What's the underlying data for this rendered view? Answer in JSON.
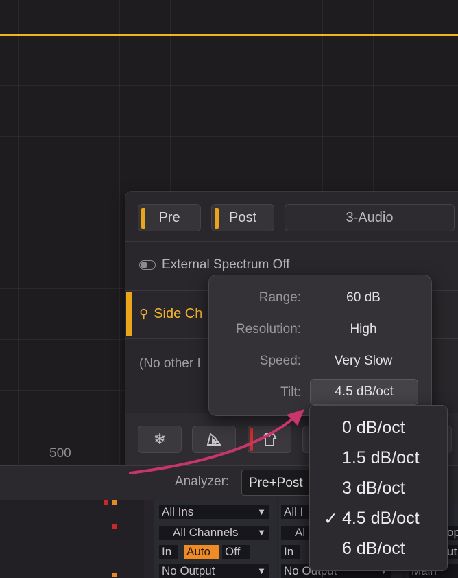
{
  "eq": {
    "freq_label": "500"
  },
  "panel": {
    "pre_label": "Pre",
    "post_label": "Post",
    "source_label": "3-Audio",
    "external_spectrum": "External Spectrum Off",
    "side_chain": "Side Ch",
    "no_other": "(No other I",
    "toolbar_icons": [
      "snowflake-icon",
      "cursor-shape-icon",
      "shirt-icon"
    ]
  },
  "popover": {
    "rows": [
      {
        "label": "Range:",
        "value": "60 dB"
      },
      {
        "label": "Resolution:",
        "value": "High"
      },
      {
        "label": "Speed:",
        "value": "Very Slow"
      },
      {
        "label": "Tilt:",
        "value": "4.5 dB/oct"
      }
    ]
  },
  "menu": {
    "items": [
      "0 dB/oct",
      "1.5 dB/oct",
      "3 dB/oct",
      "4.5 dB/oct",
      "6 dB/oct"
    ],
    "selected_index": 3,
    "check": "✓"
  },
  "analyzer_bar": {
    "label": "Analyzer:",
    "value": "Pre+Post"
  },
  "mixer": {
    "strip1": {
      "input": "All Ins",
      "channels": "All Channels",
      "in": "In",
      "auto": "Auto",
      "off": "Off",
      "output": "No Output"
    },
    "strip2": {
      "input": "All I",
      "channels": "Al",
      "in": "In",
      "output": "No Output"
    },
    "strip3": {
      "channels": "op",
      "auto": "ut",
      "output": "Main"
    }
  },
  "colors": {
    "accent": "#f2b325",
    "annotation_arrow": "#c8356a",
    "record": "#d22b2b",
    "auto": "#ef8a25"
  }
}
